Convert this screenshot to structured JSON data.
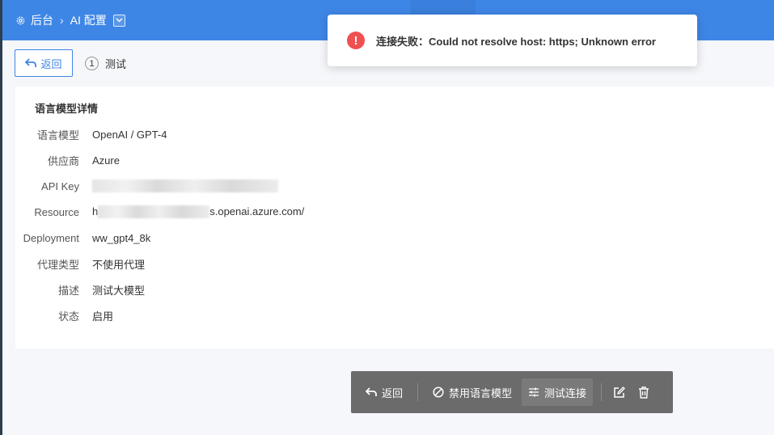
{
  "header": {
    "breadcrumbs": [
      {
        "label": "后台",
        "icon": "gear-icon"
      },
      {
        "label": "AI 配置",
        "icon": "chevron-down-icon"
      }
    ]
  },
  "toolbar": {
    "back_label": "返回",
    "step_number": "1",
    "step_label": "测试"
  },
  "detail": {
    "title": "语言模型详情",
    "fields": [
      {
        "label": "语言模型",
        "value": "OpenAI / GPT-4"
      },
      {
        "label": "供应商",
        "value": "Azure"
      },
      {
        "label": "API Key",
        "value": ""
      },
      {
        "label": "Resource",
        "value_prefix": "h",
        "value": "s.openai.azure.com/"
      },
      {
        "label": "Deployment",
        "value": "ww_gpt4_8k"
      },
      {
        "label": "代理类型",
        "value": "不使用代理"
      },
      {
        "label": "描述",
        "value": "测试大模型"
      },
      {
        "label": "状态",
        "value": "启用"
      }
    ]
  },
  "toast": {
    "type": "error",
    "message": "连接失败：Could not resolve host: https; Unknown error",
    "color": "#f05050"
  },
  "actions": {
    "back_label": "返回",
    "disable_label": "禁用语言模型",
    "test_label": "测试连接"
  },
  "colors": {
    "primary": "#3e86e6",
    "action_bar": "#6b6b6b"
  }
}
